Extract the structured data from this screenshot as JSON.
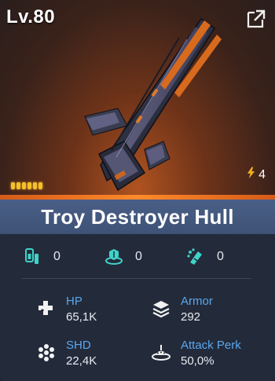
{
  "level": "Lv.80",
  "energy": {
    "value": "4",
    "icon": "lightning-bolt-icon"
  },
  "pips": {
    "filled": 6,
    "total": 6
  },
  "title": "Troy Destroyer Hull",
  "counters": [
    {
      "icon": "module-slot-icon",
      "value": "0"
    },
    {
      "icon": "shield-ring-icon",
      "value": "0"
    },
    {
      "icon": "missile-pod-icon",
      "value": "0"
    }
  ],
  "stats": [
    {
      "label": "HP",
      "value": "65,1K",
      "icon": "hp-icon"
    },
    {
      "label": "Armor",
      "value": "292",
      "icon": "armor-icon"
    },
    {
      "label": "SHD",
      "value": "22,4K",
      "icon": "hex-shield-icon"
    },
    {
      "label": "Attack Perk",
      "value": "50,0%",
      "icon": "attack-perk-icon"
    }
  ],
  "colors": {
    "accent_orange": "#ff8a2a",
    "stat_label_blue": "#5aa7ee",
    "icon_teal": "#3fd3c9",
    "title_bar": "#46597f"
  }
}
